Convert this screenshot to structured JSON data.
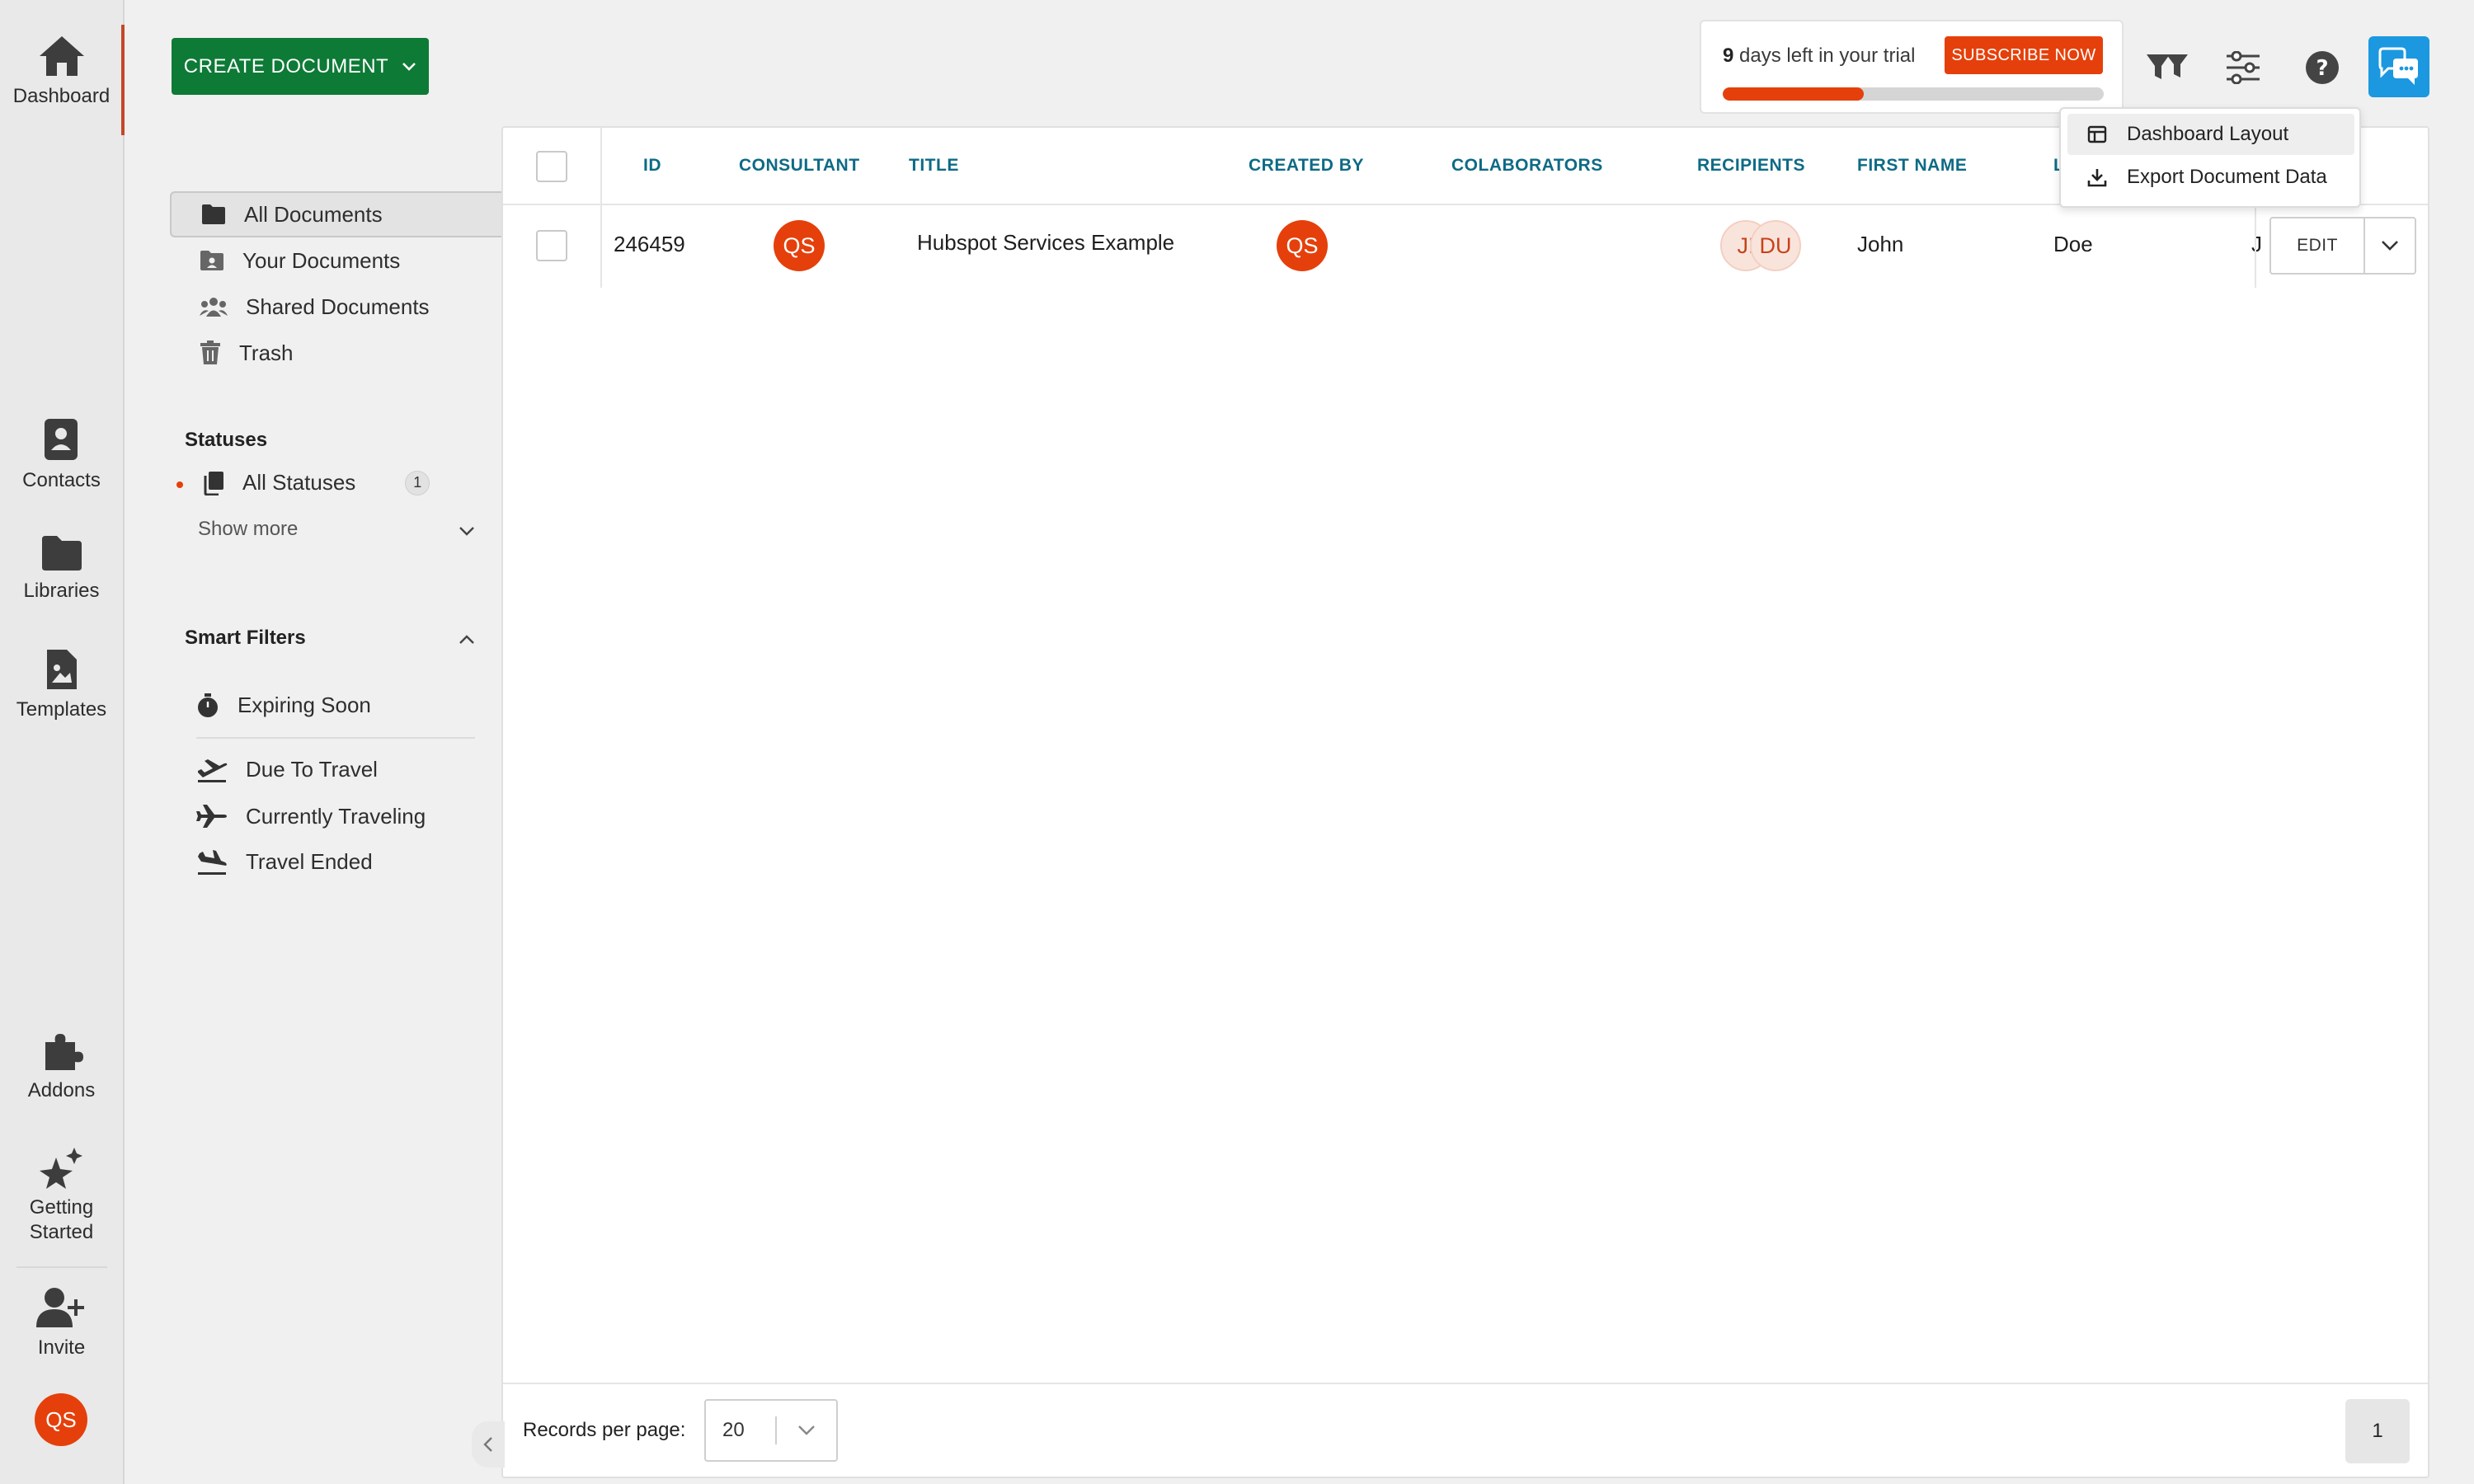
{
  "nav": {
    "dashboard": "Dashboard",
    "contacts": "Contacts",
    "libraries": "Libraries",
    "templates": "Templates",
    "addons": "Addons",
    "getting_started_1": "Getting",
    "getting_started_2": "Started",
    "invite": "Invite",
    "user_initials": "QS"
  },
  "toolbar": {
    "create_label": "CREATE DOCUMENT",
    "trial_days": "9",
    "trial_text": " days left in your trial",
    "subscribe_label": "SUBSCRIBE NOW",
    "trial_progress": 0.37
  },
  "menu": {
    "items": [
      "Dashboard Layout",
      "Export Document Data"
    ]
  },
  "folders": [
    "All Documents",
    "Your Documents",
    "Shared Documents",
    "Trash"
  ],
  "statuses": {
    "title": "Statuses",
    "all_label": "All Statuses",
    "all_count": "1",
    "show_more": "Show more"
  },
  "smart_filters": {
    "title": "Smart Filters",
    "items": [
      "Expiring Soon",
      "Due To Travel",
      "Currently Traveling",
      "Travel Ended"
    ]
  },
  "table": {
    "headers": [
      "ID",
      "CONSULTANT",
      "TITLE",
      "CREATED BY",
      "COLABORATORS",
      "RECIPIENTS",
      "FIRST NAME",
      "L"
    ],
    "rows": [
      {
        "id": "246459",
        "consultant": "QS",
        "title": "Hubspot Services Example",
        "created_by": "QS",
        "recipients": [
          "JI",
          "DU"
        ],
        "first_name": "John",
        "last_name": "Doe",
        "truncated": "J",
        "edit_label": "EDIT"
      }
    ]
  },
  "footer": {
    "rpp_label": "Records per page:",
    "rpp_value": "20",
    "page": "1"
  },
  "colors": {
    "brand_green": "#0d7a36",
    "accent_orange": "#e5400b",
    "header_teal": "#0e6a86",
    "chat_blue": "#1b98e0"
  }
}
